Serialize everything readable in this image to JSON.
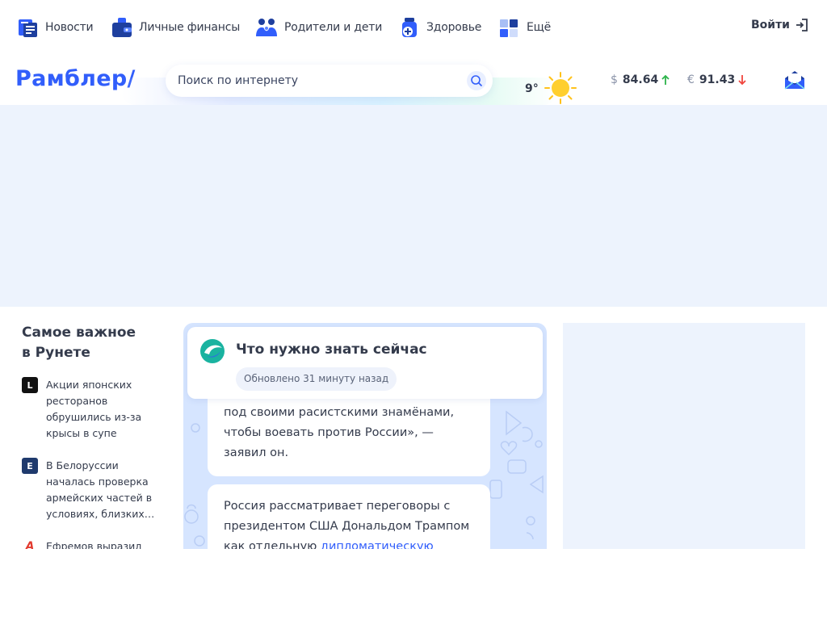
{
  "nav": {
    "items": [
      {
        "label": "Новости",
        "icon": "newspaper-icon"
      },
      {
        "label": "Личные финансы",
        "icon": "wallet-icon"
      },
      {
        "label": "Родители и дети",
        "icon": "family-icon"
      },
      {
        "label": "Здоровье",
        "icon": "medicine-icon"
      },
      {
        "label": "Ещё",
        "icon": "grid-icon"
      }
    ],
    "login_label": "Войти"
  },
  "header": {
    "logo_text": "Рамблер/",
    "search": {
      "placeholder": "Поиск по интернету",
      "value": ""
    },
    "weather": {
      "temp": "9°",
      "icon": "sun-icon"
    },
    "rates": [
      {
        "symbol": "$",
        "value": "84.64",
        "trend": "up",
        "color": "#2cb34a"
      },
      {
        "symbol": "€",
        "value": "91.43",
        "trend": "down",
        "color": "#f0453d"
      }
    ],
    "mail_icon": "mail-icon"
  },
  "colors": {
    "brand": "#315efb",
    "text": "#343b4c",
    "ad_bg": "#edf3fd",
    "feed_bg": "#d6e5ff"
  },
  "sidebar": {
    "title_line1": "Самое важное",
    "title_line2": "в Рунете",
    "news": [
      {
        "source_glyph": "L",
        "source_color": "#111111",
        "text": "Акции японских ресторанов обрушились из-за крысы в супе"
      },
      {
        "source_glyph": "E",
        "source_color": "#1f3a6d",
        "text": "В Белоруссии началась проверка армейских частей в условиях, близких…"
      },
      {
        "source_glyph": "A",
        "source_color": "#e23a2e",
        "text": "Ефремов выразил"
      }
    ]
  },
  "feed": {
    "title": "Что нужно знать сейчас",
    "updated": "Обновлено 31 минуту назад",
    "card1": {
      "partial_top": "…",
      "text": "под своими расистскими знамёнами, чтобы воевать против России», — заявил он."
    },
    "card2": {
      "text_before": "Россия рассматривает переговоры с президентом США Дональдом Трампом как отдельную ",
      "link": "дипломатическую линию"
    }
  }
}
